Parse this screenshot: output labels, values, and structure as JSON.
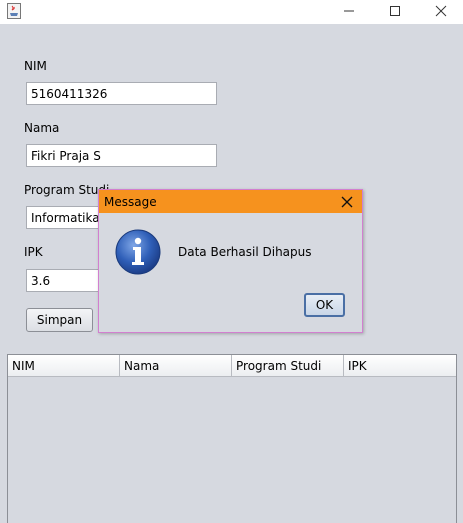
{
  "window": {
    "title": "",
    "icon": "java-icon",
    "controls": [
      "minimize-icon",
      "maximize-icon",
      "close-icon"
    ]
  },
  "form": {
    "nim_label": "NIM",
    "nim_value": "5160411326",
    "nama_label": "Nama",
    "nama_value": "Fikri Praja S",
    "prodi_label": "Program Studi",
    "prodi_value": "Informatika E",
    "ipk_label": "IPK",
    "ipk_value": "3.6",
    "save_label": "Simpan"
  },
  "table": {
    "columns": [
      "NIM",
      "Nama",
      "Program Studi",
      "IPK"
    ],
    "rows": []
  },
  "dialog": {
    "title": "Message",
    "message": "Data Berhasil Dihapus",
    "ok_label": "OK",
    "icon": "info-icon",
    "title_color": "#f6921e"
  }
}
